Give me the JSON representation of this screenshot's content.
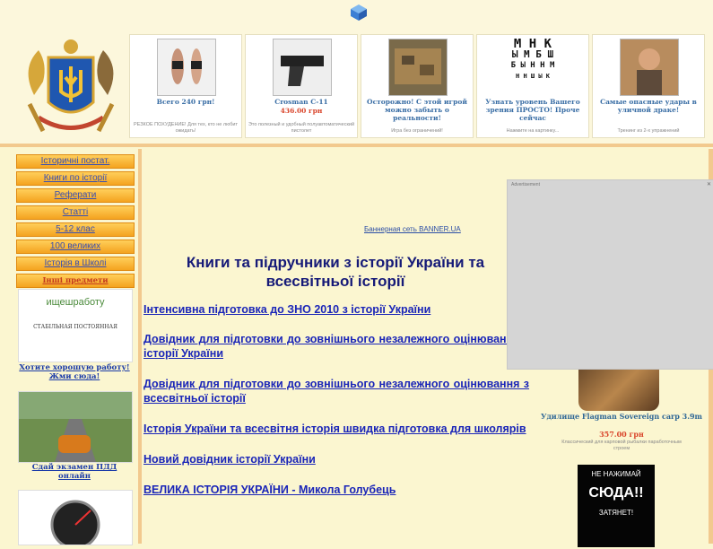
{
  "header": {
    "ads": [
      {
        "title": "Всего 240 грн!",
        "price": "",
        "desc": "РЕЗКОЕ ПОХУДЕНИЕ! Для тех, кто не любит ожидать!"
      },
      {
        "title": "Crosman C-11",
        "price": "436.00 грн",
        "desc": "Это полезный и удобный полуавтоматический пистолет"
      },
      {
        "title": "Осторожно! С этой игрой можно забыть о реальности!",
        "price": "",
        "desc": "Игра без ограничений!"
      },
      {
        "title": "Узнать уровень Вашего зрения ПРОСТО! Проче сейчас",
        "price": "",
        "desc": "Нажмите на картинку..."
      },
      {
        "title": "Самые опасные удары в уличной драке!",
        "price": "",
        "desc": "Тренинг из 2-х упражнений"
      }
    ],
    "chart_text": [
      "М Н К",
      "Ы М Б Ш",
      "Б Ы Н Н М",
      "Н Н Ш Ы К"
    ]
  },
  "menu": [
    "Історичні постат.",
    "Книги по історії",
    "Реферати",
    "Статті",
    "5-12 клас",
    "100 великих",
    "Історія в Школі",
    "Інші предмети"
  ],
  "left": {
    "job_logo": "ищешработу",
    "job_sub": "СТАБІЛЬНАЯ ПОСТОЯННАЯ",
    "job_caption": "Хотите хорошую работу! Жми сюда!",
    "pdd_caption": "Сдай экзамен ПДД онлайн"
  },
  "banner": {
    "link": "Баннерная сеть BANNER.UA"
  },
  "main": {
    "title": "Книги та підручники з історії України та всесвітньої історії",
    "articles": [
      "Інтенсивна підготовка до ЗНО 2010 з історії України",
      "Довідник для підготовки до зовнішнього незалежного оцінювання з історії України",
      "Довідник для підготовки до зовнішнього незалежного оцінювання з всесвітньої історії",
      "Історія України та всесвітня історія швидка підготовка для школярів",
      "Новий довідник історії України",
      "ВЕЛИКА ІСТОРІЯ УКРАЇНИ - Микола Голубець"
    ]
  },
  "gray_ad": {
    "label": "Advertisement"
  },
  "right": {
    "title": "Удилище Flagman Sovereign carp 3.9m",
    "price": "357.00 грн",
    "desc": "Классический для карповой рыбалки паработочным строем",
    "black_top": "НЕ НАЖИМАЙ",
    "black_mid": "СЮДА!!",
    "black_bot": "ЗАТЯНЕТ!"
  }
}
